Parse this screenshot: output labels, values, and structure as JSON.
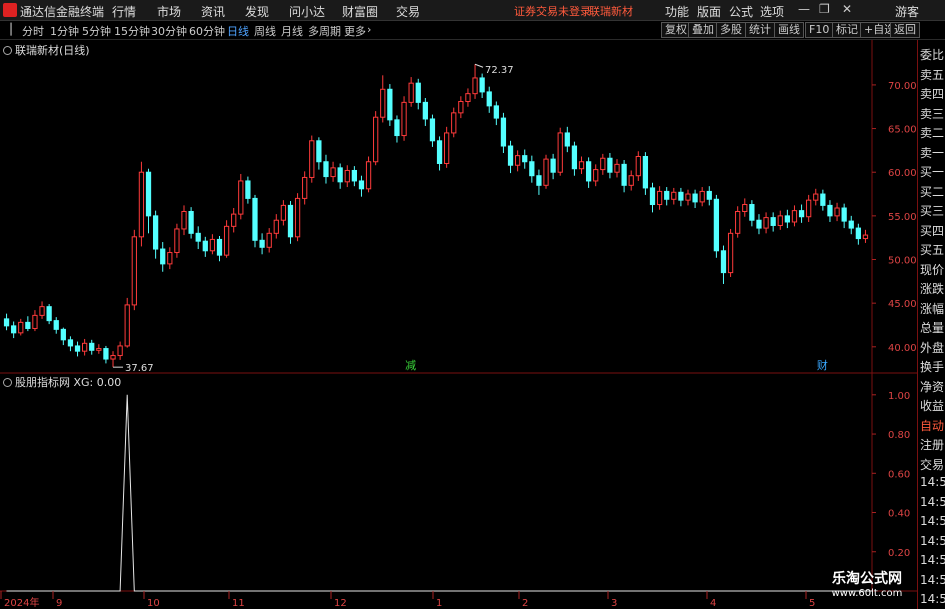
{
  "menubar": {
    "app_title": "通达信金融终端",
    "items": [
      "行情",
      "市场",
      "资讯",
      "发现",
      "问小达",
      "财富圈",
      "交易"
    ],
    "warning": "证券交易未登录",
    "stock_name": "联瑞新材",
    "right_items": [
      "功能",
      "版面",
      "公式",
      "选项"
    ],
    "guest": "游客"
  },
  "toolbar": {
    "periods": [
      "分时",
      "1分钟",
      "5分钟",
      "15分钟",
      "30分钟",
      "60分钟",
      "日线",
      "周线",
      "月线",
      "多周期",
      "更多"
    ],
    "active_period": "日线",
    "buttons": [
      "复权",
      "叠加",
      "多股",
      "统计",
      "画线",
      "F10",
      "标记",
      "+自选",
      "返回"
    ]
  },
  "main_pane": {
    "title": "联瑞新材(日线)",
    "y_ticks": [
      "70.00",
      "65.00",
      "60.00",
      "55.00",
      "50.00",
      "45.00",
      "40.00"
    ],
    "high_label": "72.37",
    "low_label": "37.67",
    "markers": [
      "减",
      "财"
    ]
  },
  "indicator_pane": {
    "title": "股朋指标网 XG: 0.00",
    "y_ticks": [
      "1.00",
      "0.80",
      "0.60",
      "0.40",
      "0.20"
    ]
  },
  "x_axis": {
    "labels": [
      "2024年",
      "9",
      "10",
      "11",
      "12",
      "1",
      "2",
      "3",
      "4",
      "5"
    ]
  },
  "right_panel": {
    "items": [
      "委比",
      "卖五",
      "卖四",
      "卖三",
      "卖二",
      "卖一",
      "买一",
      "买二",
      "买三",
      "买四",
      "买五",
      "现价",
      "涨跌",
      "涨幅",
      "总量",
      "外盘",
      "换手",
      "净资",
      "收益",
      "自动",
      "注册",
      "交易",
      "14:55",
      "14:55",
      "14:55",
      "14:56",
      "14:56",
      "14:56",
      "14:56"
    ],
    "highlight": "自动"
  },
  "watermark": {
    "title": "乐淘公式网",
    "url": "www.60lt.com"
  },
  "chart_data": {
    "type": "candlestick",
    "series": [
      {
        "name": "K",
        "values": [
          [
            43.2,
            42.4,
            43.8,
            41.9
          ],
          [
            42.4,
            41.6,
            42.9,
            41.0
          ],
          [
            41.6,
            42.8,
            43.2,
            41.3
          ],
          [
            42.8,
            42.1,
            43.5,
            41.8
          ],
          [
            42.1,
            43.6,
            44.2,
            41.8
          ],
          [
            43.6,
            44.6,
            45.2,
            43.2
          ],
          [
            44.6,
            43.0,
            44.9,
            42.6
          ],
          [
            43.0,
            42.0,
            43.4,
            41.5
          ],
          [
            42.0,
            40.8,
            42.2,
            40.2
          ],
          [
            40.8,
            40.1,
            41.2,
            39.5
          ],
          [
            40.1,
            39.5,
            40.6,
            38.9
          ],
          [
            39.5,
            40.4,
            40.9,
            39.0
          ],
          [
            40.4,
            39.6,
            40.8,
            39.1
          ],
          [
            39.6,
            39.8,
            40.3,
            39.2
          ],
          [
            39.8,
            38.6,
            40.1,
            38.1
          ],
          [
            38.6,
            39.0,
            39.5,
            37.67
          ],
          [
            39.0,
            40.1,
            40.6,
            38.5
          ],
          [
            40.1,
            44.8,
            45.6,
            39.9
          ],
          [
            44.8,
            52.6,
            53.4,
            44.2
          ],
          [
            52.6,
            60.0,
            61.2,
            51.5
          ],
          [
            60.0,
            55.0,
            60.4,
            53.0
          ],
          [
            55.0,
            51.2,
            55.6,
            50.1
          ],
          [
            51.2,
            49.5,
            52.0,
            48.6
          ],
          [
            49.5,
            50.8,
            51.4,
            48.9
          ],
          [
            50.8,
            53.5,
            54.1,
            50.2
          ],
          [
            53.5,
            55.5,
            56.2,
            52.8
          ],
          [
            55.5,
            53.0,
            56.0,
            52.4
          ],
          [
            53.0,
            52.1,
            53.8,
            51.2
          ],
          [
            52.1,
            51.0,
            52.6,
            50.3
          ],
          [
            51.0,
            52.3,
            52.9,
            50.6
          ],
          [
            52.3,
            50.5,
            52.7,
            49.8
          ],
          [
            50.5,
            53.8,
            54.5,
            50.2
          ],
          [
            53.8,
            55.2,
            55.9,
            53.1
          ],
          [
            55.2,
            59.0,
            59.8,
            54.6
          ],
          [
            59.0,
            57.0,
            59.5,
            56.4
          ],
          [
            57.0,
            52.2,
            57.4,
            51.4
          ],
          [
            52.2,
            51.4,
            53.0,
            50.6
          ],
          [
            51.4,
            53.0,
            53.6,
            50.8
          ],
          [
            53.0,
            54.5,
            55.2,
            52.4
          ],
          [
            54.5,
            56.2,
            56.8,
            53.9
          ],
          [
            56.2,
            52.6,
            56.7,
            51.8
          ],
          [
            52.6,
            57.0,
            57.6,
            52.1
          ],
          [
            57.0,
            59.4,
            60.1,
            56.3
          ],
          [
            59.4,
            63.6,
            64.2,
            58.8
          ],
          [
            63.6,
            61.2,
            64.0,
            60.3
          ],
          [
            61.2,
            59.5,
            62.0,
            58.7
          ],
          [
            59.5,
            60.5,
            61.2,
            58.9
          ],
          [
            60.5,
            58.9,
            61.0,
            58.1
          ],
          [
            58.9,
            60.2,
            60.8,
            58.3
          ],
          [
            60.2,
            59.0,
            60.7,
            58.4
          ],
          [
            59.0,
            58.1,
            59.6,
            57.2
          ],
          [
            58.1,
            61.2,
            61.8,
            57.7
          ],
          [
            61.2,
            66.3,
            67.0,
            60.8
          ],
          [
            66.3,
            69.5,
            71.1,
            65.7
          ],
          [
            69.5,
            66.0,
            70.1,
            65.3
          ],
          [
            66.0,
            64.2,
            66.5,
            63.4
          ],
          [
            64.2,
            68.0,
            68.7,
            63.6
          ],
          [
            68.0,
            70.2,
            70.9,
            67.5
          ],
          [
            70.2,
            68.0,
            70.7,
            67.2
          ],
          [
            68.0,
            66.1,
            68.5,
            65.3
          ],
          [
            66.1,
            63.6,
            66.6,
            62.9
          ],
          [
            63.6,
            61.0,
            64.1,
            60.2
          ],
          [
            61.0,
            64.5,
            65.2,
            60.5
          ],
          [
            64.5,
            66.8,
            67.4,
            64.0
          ],
          [
            66.8,
            68.1,
            68.7,
            66.2
          ],
          [
            68.1,
            69.0,
            69.6,
            67.5
          ],
          [
            69.0,
            70.8,
            72.37,
            68.4
          ],
          [
            70.8,
            69.2,
            71.3,
            68.5
          ],
          [
            69.2,
            67.6,
            69.8,
            66.8
          ],
          [
            67.6,
            66.2,
            68.1,
            65.4
          ],
          [
            66.2,
            63.0,
            66.8,
            62.2
          ],
          [
            63.0,
            60.8,
            63.6,
            59.9
          ],
          [
            60.8,
            61.9,
            62.5,
            60.1
          ],
          [
            61.9,
            61.2,
            62.6,
            60.4
          ],
          [
            61.2,
            59.6,
            61.9,
            58.8
          ],
          [
            59.6,
            58.5,
            60.3,
            57.4
          ],
          [
            58.5,
            61.5,
            62.0,
            58.1
          ],
          [
            61.5,
            60.0,
            62.1,
            59.2
          ],
          [
            60.0,
            64.5,
            65.1,
            59.6
          ],
          [
            64.5,
            63.0,
            65.2,
            62.3
          ],
          [
            63.0,
            60.4,
            63.5,
            59.6
          ],
          [
            60.4,
            61.2,
            61.8,
            59.8
          ],
          [
            61.2,
            59.0,
            61.7,
            58.2
          ],
          [
            59.0,
            60.3,
            60.9,
            58.4
          ],
          [
            60.3,
            61.6,
            62.1,
            59.7
          ],
          [
            61.6,
            60.0,
            62.2,
            59.3
          ],
          [
            60.0,
            60.9,
            61.5,
            59.4
          ],
          [
            60.9,
            58.5,
            61.4,
            57.7
          ],
          [
            58.5,
            59.6,
            60.2,
            57.9
          ],
          [
            59.6,
            61.8,
            62.4,
            59.0
          ],
          [
            61.8,
            58.2,
            62.3,
            57.4
          ],
          [
            58.2,
            56.3,
            58.8,
            55.4
          ],
          [
            56.3,
            57.8,
            58.4,
            55.7
          ],
          [
            57.8,
            56.9,
            58.3,
            56.2
          ],
          [
            56.9,
            57.7,
            58.2,
            56.3
          ],
          [
            57.7,
            56.8,
            58.2,
            56.1
          ],
          [
            56.8,
            57.5,
            58.0,
            56.2
          ],
          [
            57.5,
            56.6,
            58.0,
            55.9
          ],
          [
            56.6,
            57.8,
            58.3,
            56.1
          ],
          [
            57.8,
            56.9,
            58.4,
            56.2
          ],
          [
            56.9,
            51.0,
            57.4,
            50.2
          ],
          [
            51.0,
            48.5,
            51.6,
            47.2
          ],
          [
            48.5,
            53.0,
            53.5,
            48.0
          ],
          [
            53.0,
            55.5,
            56.1,
            52.5
          ],
          [
            55.5,
            56.3,
            57.0,
            54.9
          ],
          [
            56.3,
            54.5,
            56.8,
            53.8
          ],
          [
            54.5,
            53.6,
            55.2,
            52.9
          ],
          [
            53.6,
            54.8,
            55.4,
            53.0
          ],
          [
            54.8,
            53.9,
            55.4,
            53.2
          ],
          [
            53.9,
            55.0,
            55.6,
            53.4
          ],
          [
            55.0,
            54.3,
            55.7,
            53.6
          ],
          [
            54.3,
            55.6,
            56.2,
            53.8
          ],
          [
            55.6,
            54.9,
            56.3,
            54.2
          ],
          [
            54.9,
            56.8,
            57.4,
            54.3
          ],
          [
            56.8,
            57.5,
            58.1,
            56.2
          ],
          [
            57.5,
            56.2,
            58.0,
            55.6
          ],
          [
            56.2,
            55.0,
            56.8,
            54.3
          ],
          [
            55.0,
            55.9,
            56.5,
            54.4
          ],
          [
            55.9,
            54.4,
            56.4,
            53.6
          ],
          [
            54.4,
            53.6,
            55.0,
            52.9
          ],
          [
            53.6,
            52.4,
            54.1,
            51.7
          ],
          [
            52.4,
            52.8,
            53.4,
            51.9
          ]
        ]
      },
      {
        "name": "XG",
        "values": [
          0,
          0,
          0,
          0,
          0,
          0,
          0,
          0,
          0,
          0,
          0,
          0,
          0,
          0,
          0,
          0,
          0,
          1,
          0,
          0,
          0,
          0,
          0,
          0,
          0,
          0,
          0,
          0,
          0,
          0,
          0,
          0,
          0,
          0,
          0,
          0,
          0,
          0,
          0,
          0,
          0,
          0,
          0,
          0,
          0,
          0,
          0,
          0,
          0,
          0,
          0,
          0,
          0,
          0,
          0,
          0,
          0,
          0,
          0,
          0,
          0,
          0,
          0,
          0,
          0,
          0,
          0,
          0,
          0,
          0,
          0,
          0,
          0,
          0,
          0,
          0,
          0,
          0,
          0,
          0,
          0,
          0,
          0,
          0,
          0,
          0,
          0,
          0,
          0,
          0,
          0,
          0,
          0,
          0,
          0,
          0,
          0,
          0,
          0,
          0,
          0,
          0,
          0,
          0,
          0,
          0,
          0,
          0,
          0,
          0,
          0,
          0,
          0,
          0,
          0,
          0,
          0,
          0,
          0,
          0,
          0,
          0,
          0
        ]
      }
    ],
    "xg_signal_positions": [
      17,
      57,
      93,
      115
    ],
    "main_ylim": [
      37.0,
      74.0
    ],
    "indicator_ylim": [
      0,
      1.05
    ]
  }
}
